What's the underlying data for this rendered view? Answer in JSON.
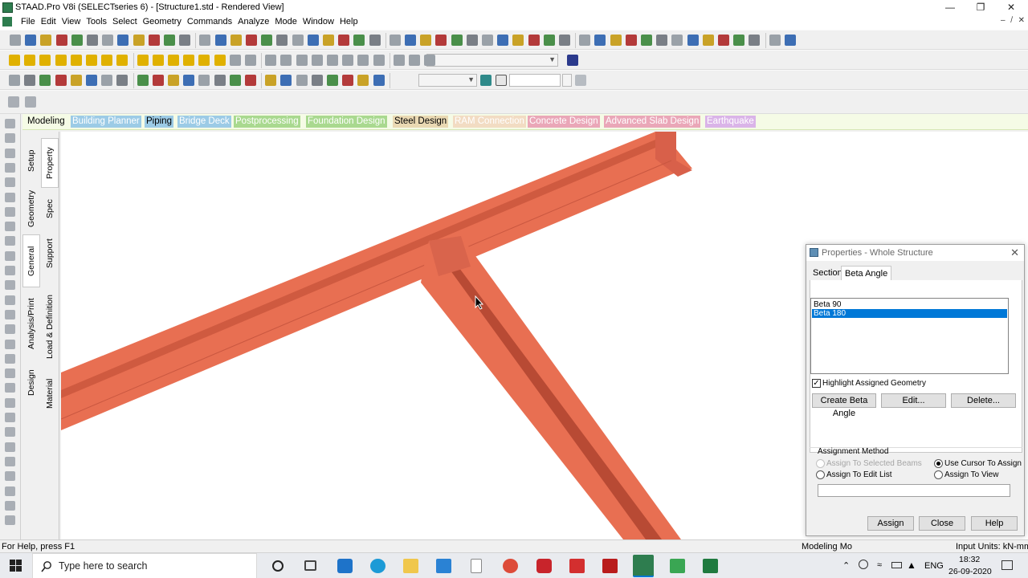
{
  "window": {
    "title": "STAAD.Pro V8i (SELECTseries 6) - [Structure1.std - Rendered View]",
    "minimize": "—",
    "restore": "❐",
    "close": "✕"
  },
  "menu": [
    "File",
    "Edit",
    "View",
    "Tools",
    "Select",
    "Geometry",
    "Commands",
    "Analyze",
    "Mode",
    "Window",
    "Help"
  ],
  "mdi_controls": [
    "–",
    "̸",
    "✕"
  ],
  "tabs": [
    {
      "label": "Modeling",
      "color": "#000000",
      "bg": "transparent"
    },
    {
      "label": "Building Planner",
      "color": "#ffffff",
      "bg": "#9ccbe6"
    },
    {
      "label": "Piping",
      "color": "#000000",
      "bg": "#9ccbe6"
    },
    {
      "label": "Bridge Deck",
      "color": "#ffffff",
      "bg": "#9ccbe6"
    },
    {
      "label": "Postprocessing",
      "color": "#ffffff",
      "bg": "#a9d98f"
    },
    {
      "label": "Foundation Design",
      "color": "#ffffff",
      "bg": "#a9d98f"
    },
    {
      "label": "Steel Design",
      "color": "#000000",
      "bg": "#ead9b3"
    },
    {
      "label": "RAM Connection",
      "color": "#ffffff",
      "bg": "#f2dcc3"
    },
    {
      "label": "Concrete Design",
      "color": "#ffffff",
      "bg": "#eaa7b8"
    },
    {
      "label": "Advanced Slab Design",
      "color": "#ffffff",
      "bg": "#eaa7b8"
    },
    {
      "label": "Earthquake",
      "color": "#ffffff",
      "bg": "#dab4e8"
    }
  ],
  "page_control": {
    "outer": [
      "Setup",
      "Geometry",
      "General",
      "Analysis/Print",
      "Design"
    ],
    "inner": [
      "Property",
      "Spec",
      "Support",
      "Load & Definition",
      "Material"
    ]
  },
  "properties": {
    "title": "Properties - Whole Structure",
    "tabs": [
      "Section",
      "Beta Angle"
    ],
    "list": [
      "Beta 90",
      "Beta 180"
    ],
    "selected_index": 1,
    "highlight_label": "Highlight Assigned Geometry",
    "highlight_checked": true,
    "buttons": {
      "create": "Create Beta Angle",
      "edit": "Edit...",
      "delete": "Delete..."
    },
    "assign_group": "Assignment Method",
    "radios": {
      "selected_beams": "Assign To Selected Beams",
      "edit_list": "Assign To Edit List",
      "use_cursor": "Use Cursor To Assign",
      "to_view": "Assign To View"
    },
    "footer": {
      "assign": "Assign",
      "close": "Close",
      "help": "Help"
    }
  },
  "status": {
    "help": "For Help, press F1",
    "mode": "Modeling Mo",
    "units": "Input Units:  kN-mm"
  },
  "taskbar": {
    "search_placeholder": "Type here to search",
    "lang": "ENG",
    "time": "18:32",
    "date": "26-09-2020"
  },
  "colors": {
    "beam": "#e86f52",
    "beam_dark": "#b84a34",
    "selection": "#0078d7"
  }
}
